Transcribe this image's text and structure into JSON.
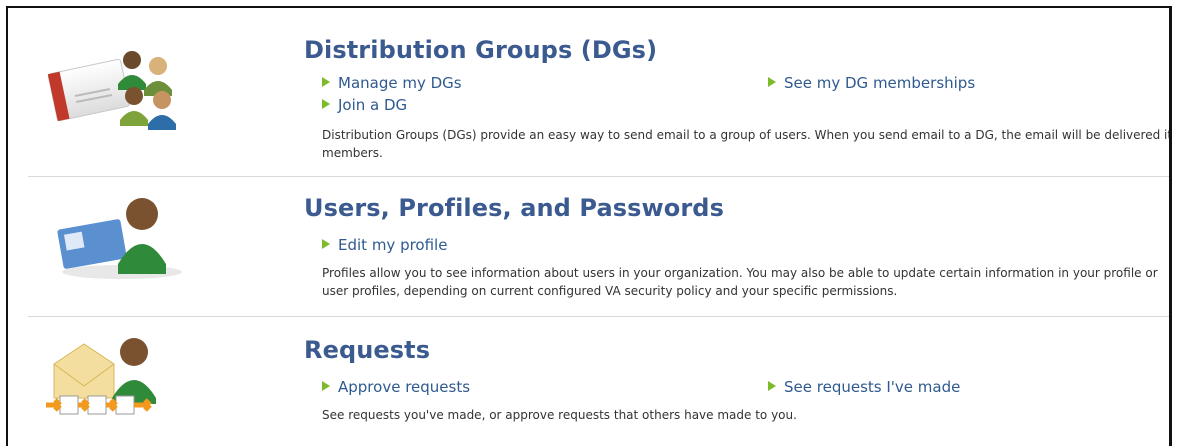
{
  "sections": [
    {
      "title": "Distribution Groups (DGs)",
      "links": [
        "Manage my DGs",
        "See my DG memberships",
        "Join a DG"
      ],
      "description": "Distribution Groups (DGs) provide an easy way to send email to a group of users. When you send email to a DG, the email will be delivered its members.",
      "icon": "distribution-groups-icon"
    },
    {
      "title": "Users, Profiles, and Passwords",
      "links": [
        "Edit my profile"
      ],
      "description": "Profiles allow you to see information about users in your organization. You may also be able to update certain information in your profile or user profiles, depending on current configured VA security policy and your specific permissions.",
      "icon": "user-profile-icon"
    },
    {
      "title": "Requests",
      "links": [
        "Approve requests",
        "See requests I've made"
      ],
      "description": "See requests you've made, or approve requests that others have made to you.",
      "icon": "requests-icon"
    }
  ],
  "colors": {
    "title": "#3b5a8f",
    "link": "#2f5a8f",
    "arrow": "#7dbb2b",
    "divider": "#d9d9d9"
  }
}
